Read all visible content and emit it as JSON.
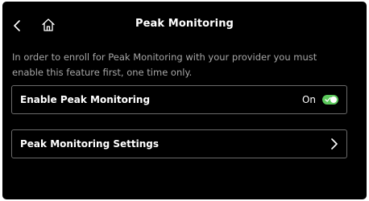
{
  "header": {
    "title": "Peak Monitoring",
    "back_icon": "chevron-left-icon",
    "home_icon": "home-icon"
  },
  "description": "In order to enroll for Peak Monitoring with your provider you must enable this feature first, one time only.",
  "settings": {
    "enable_row": {
      "label": "Enable Peak Monitoring",
      "status": "On",
      "toggle_on": true,
      "toggle_color": "#5bc85b"
    },
    "settings_row": {
      "label": "Peak Monitoring Settings",
      "chevron_icon": "chevron-right-icon"
    }
  },
  "colors": {
    "background": "#000000",
    "text": "#ffffff",
    "muted_text": "#a6a6a6",
    "border": "#6b6b6b"
  }
}
